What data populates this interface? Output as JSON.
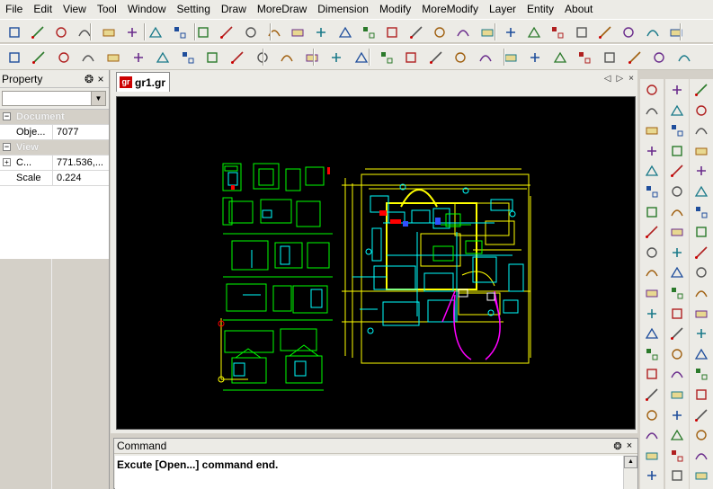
{
  "menu": [
    "File",
    "Edit",
    "View",
    "Tool",
    "Window",
    "Setting",
    "Draw",
    "MoreDraw",
    "Dimension",
    "Modify",
    "MoreModify",
    "Layer",
    "Entity",
    "About"
  ],
  "property_panel": {
    "title": "Property",
    "pin": "❂",
    "close": "×",
    "categories": [
      {
        "label": "Document",
        "expander": "⊟",
        "rows": [
          {
            "key": "Obje...",
            "value": "7077",
            "expander": ""
          }
        ]
      },
      {
        "label": "View",
        "expander": "⊟",
        "rows": [
          {
            "key": "C...",
            "value": "771.536,...",
            "expander": "+"
          },
          {
            "key": "Scale",
            "value": "0.224",
            "expander": ""
          }
        ]
      }
    ]
  },
  "document": {
    "tab_icon_text": "gr",
    "tab_label": "gr1.gr",
    "ctrl_prev": "◁",
    "ctrl_next": "▷",
    "ctrl_close": "×"
  },
  "command": {
    "title": "Command",
    "pin": "❂",
    "close": "×",
    "output": "Excute [Open...] command end."
  },
  "colors": {
    "canvas": "#000000",
    "cad_yellow": "#ffff00",
    "cad_cyan": "#00ffff",
    "cad_green": "#00ff00",
    "cad_red": "#ff0000",
    "cad_magenta": "#ff00ff",
    "cad_blue": "#3050ff"
  },
  "toolbars": {
    "row1": [
      "new-file-icon",
      "open-folder-icon",
      "save-icon",
      "save-all-icon",
      "print-preview-icon",
      "print-icon",
      "undo-icon",
      "redo-icon",
      "copy-icon",
      "cut-icon",
      "paste-icon",
      "brush-icon",
      "line-tool-icon",
      "node-icon",
      "mirror-icon",
      "array-icon",
      "move-icon",
      "rotate-icon",
      "scale-icon",
      "stretch-icon",
      "explode-icon",
      "trim-icon",
      "extend-icon",
      "break-icon",
      "join-icon",
      "fillet-icon",
      "chamfer-icon",
      "offset-icon",
      "layers-icon"
    ],
    "row2": [
      "point-icon",
      "line-icon",
      "polyline-icon",
      "rectangle-icon",
      "polygon-icon",
      "arc-icon",
      "circle-icon",
      "spline-icon",
      "ellipse-icon",
      "xline-icon",
      "hatch-icon",
      "cloud-icon",
      "text-icon",
      "mtext-icon",
      "block-insert-icon",
      "block-make-icon",
      "region-icon",
      "table-icon",
      "image-icon",
      "polar-icon",
      "wave-icon",
      "dim-linear-icon",
      "dim-aligned-icon",
      "dim-radius-icon",
      "dim-angle-icon",
      "dim-arc-icon",
      "dim-leader-icon",
      "dim-ordinate-icon"
    ],
    "right_col1": [
      "zoom-window-icon",
      "zoom-prev-icon",
      "zoom-realtime-icon",
      "pan-icon",
      "zoom-all-icon",
      "zoom-extents-icon",
      "zoom-in-icon",
      "zoom-out-icon",
      "zoom-scale-icon",
      "redraw-icon",
      "regen-icon",
      "view-icon",
      "layer-on-icon",
      "layer-lock-icon",
      "layer-freeze-icon",
      "layer-color-icon",
      "layer-print-icon",
      "layer-delete-icon",
      "layer-prop-icon",
      "layer-match-icon"
    ],
    "right_col2": [
      "snap-end-icon",
      "snap-mid-icon",
      "snap-center-icon",
      "snap-node-icon",
      "snap-quad-icon",
      "snap-int-icon",
      "snap-ext-icon",
      "snap-ins-icon",
      "snap-perp-icon",
      "snap-tan-icon",
      "snap-near-icon",
      "snap-app-icon",
      "snap-par-icon",
      "snap-none-icon",
      "snap-xyz-icon",
      "snap-track-icon",
      "ortho-icon",
      "grid-icon",
      "polar-track-icon",
      "otrack-icon"
    ]
  }
}
